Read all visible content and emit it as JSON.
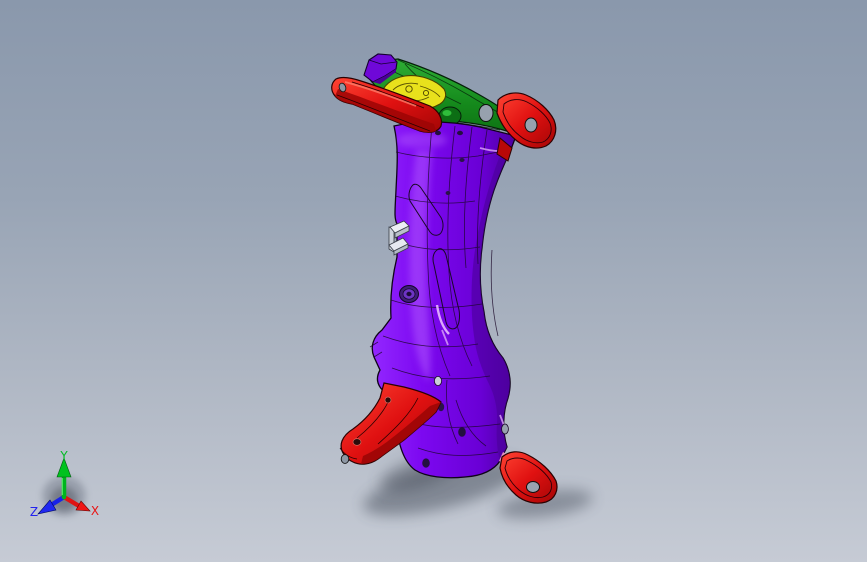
{
  "viewport": {
    "type": "cad-3d-viewport",
    "background_top_color": "#8a98ac",
    "background_bottom_color": "#c6cbd5"
  },
  "triad": {
    "x_label": "X",
    "x_color": "#e81414",
    "y_label": "Y",
    "y_color": "#00bb22",
    "z_label": "Z",
    "z_color": "#2222ee"
  },
  "model": {
    "parts": [
      {
        "id": "main-frame",
        "color": "#7c08f0"
      },
      {
        "id": "upper-crossmember",
        "color": "#158a1c"
      },
      {
        "id": "mount-insert",
        "color": "#e8e11c"
      },
      {
        "id": "upper-left-arm",
        "color": "#e01111"
      },
      {
        "id": "upper-right-bracket",
        "color": "#e01111"
      },
      {
        "id": "lower-left-arm",
        "color": "#e01111"
      },
      {
        "id": "lower-right-bracket",
        "color": "#e01111"
      },
      {
        "id": "side-clip",
        "color": "#e9ecf2"
      },
      {
        "id": "top-clip",
        "color": "#6f08d8"
      }
    ]
  }
}
